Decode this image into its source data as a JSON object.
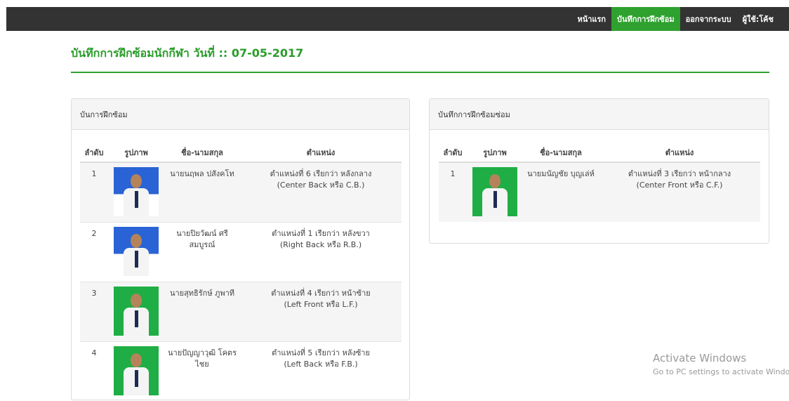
{
  "nav": {
    "items": [
      {
        "label": "หน้าแรก"
      },
      {
        "label": "บันทึกการฝึกซ้อม"
      },
      {
        "label": "ออกจากระบบ"
      },
      {
        "label": "ผู้ใช้:โค้ช"
      }
    ]
  },
  "page_title": "บันทึกการฝึกซ้อมนักกีฬา  วันที่ :: 07-05-2017",
  "left_panel": {
    "heading": "บันการฝึกซ้อม",
    "columns": [
      "ลำดับ",
      "รูปภาพ",
      "ชื่อ-นามสกุล",
      "ตำแหน่ง"
    ],
    "rows": [
      {
        "no": "1",
        "name": "นายนฤพล ปสังคโท",
        "position_line1": "ตำแหน่งที่ 6 เรียกว่า หลังกลาง",
        "position_line2": "(Center Back หรือ C.B.)"
      },
      {
        "no": "2",
        "name": "นายปิยวัฒน์ ศรีสมบูรณ์",
        "position_line1": "ตำแหน่งที่ 1 เรียกว่า หลังขวา",
        "position_line2": "(Right Back หรือ R.B.)"
      },
      {
        "no": "3",
        "name": "นายสุทธิรักษ์ ภูพาที",
        "position_line1": "ตำแหน่งที่ 4 เรียกว่า หน้าซ้าย",
        "position_line2": "(Left Front หรือ L.F.)"
      },
      {
        "no": "4",
        "name": "นายปัญญาวุฒิ โคตรไชย",
        "position_line1": "ตำแหน่งที่ 5 เรียกว่า หลังซ้าย",
        "position_line2": "(Left Back หรือ F.B.)"
      }
    ]
  },
  "right_panel": {
    "heading": "บันทึกการฝึกซ้อมซ่อม",
    "columns": [
      "ลำดับ",
      "รูปภาพ",
      "ชื่อ-นามสกุล",
      "ตำแหน่ง"
    ],
    "rows": [
      {
        "no": "1",
        "name": "นายมนัญชัย บุญเล่ห์",
        "position_line1": "ตำแหน่งที่ 3 เรียกว่า หน้ากลาง",
        "position_line2": "(Center Front หรือ C.F.)"
      }
    ]
  },
  "watermark": {
    "title": "Activate Windows",
    "subtitle": "Go to PC settings to activate Windows."
  }
}
